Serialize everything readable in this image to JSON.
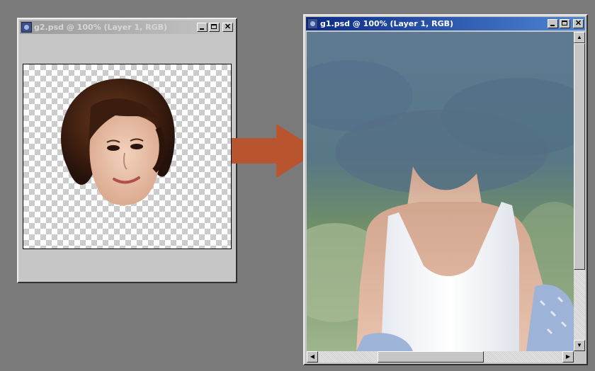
{
  "source_window": {
    "title": "g2.psd @ 100% (Layer 1, RGB)",
    "state": "inactive",
    "canvas": "transparent layer with cut-out head"
  },
  "target_window": {
    "title": "g1.psd @ 100% (Layer 1, RGB)",
    "state": "active",
    "canvas": "photo of person in white tank top, head area blurred"
  },
  "arrow": {
    "color": "#b8552e",
    "icon": "right-arrow-icon"
  },
  "controls": {
    "minimize": "minimize-icon",
    "maximize": "maximize-icon",
    "close": "close-icon"
  },
  "colors": {
    "desktop": "#7a7a7a",
    "active_title": "#0a2a86",
    "inactive_title": "#9a9a9a"
  }
}
